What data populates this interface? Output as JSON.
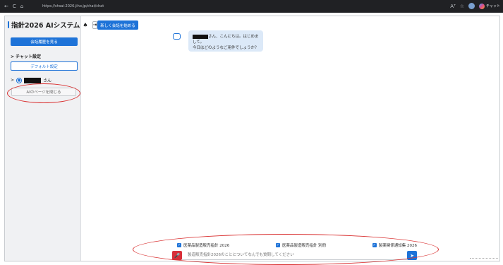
{
  "browser": {
    "url": "https://shsai-2026.jiho.jp/chat/chat",
    "back_icon": "←",
    "reload_icon": "C",
    "home_icon": "⌂",
    "read_aloud_icon": "Aᵀ",
    "favorite_icon": "☆",
    "extension_label": "チャット"
  },
  "sidebar": {
    "app_title": "指針2026 AIシステム",
    "home_icon": "♠",
    "collapse_icon": "⇥",
    "history_button": "会話履歴を見る",
    "chat_settings_label": "> チャット設定",
    "default_settings_button": "デフォルト設定",
    "user_chevron": ">",
    "user_suffix": "さん",
    "close_ai_button": "AIのページを閉じる"
  },
  "main": {
    "new_chat_button": "新しく会話を始める",
    "bot_message_line1_suffix": "さん、こんにちは。はじめまして。",
    "bot_message_line2": "今日はどのようなご用件でしょうか？",
    "checkboxes": [
      {
        "label": "医薬品製造販売指針 2026",
        "checked": true
      },
      {
        "label": "医薬品製造販売指針 別冊",
        "checked": true
      },
      {
        "label": "製薬関係通知集 2026",
        "checked": true
      }
    ],
    "input_placeholder": "製造販売指針2026のことについてなんでも質問してください",
    "mic_icon": "🎤",
    "send_icon": "➤"
  },
  "colors": {
    "accent": "#1e73d8",
    "danger": "#d8303a",
    "annotation": "#d93030",
    "bubble": "#dce9f8"
  }
}
